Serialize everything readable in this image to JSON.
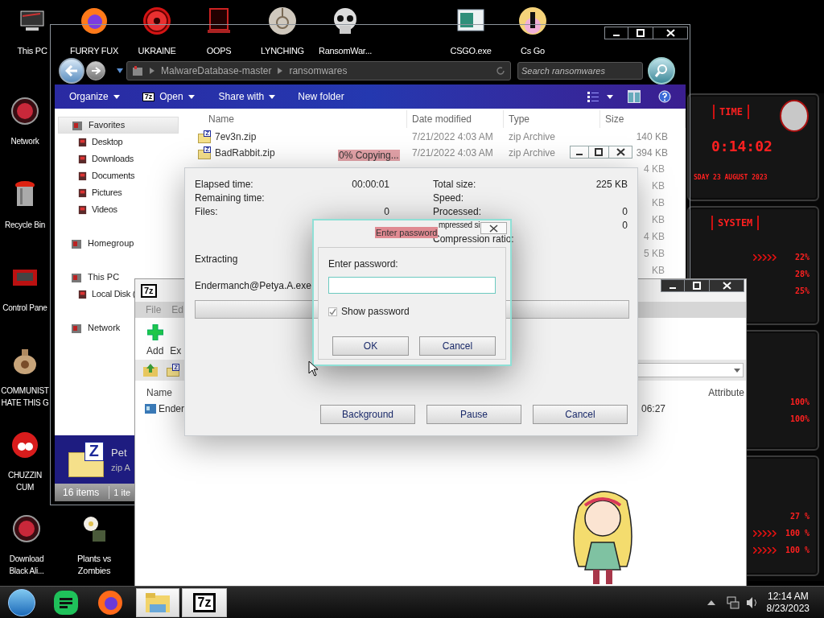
{
  "desktop_icons": {
    "top": [
      {
        "label": "This PC",
        "kind": "pc"
      },
      {
        "label": "FURRY FUX",
        "kind": "firefox"
      },
      {
        "label": "UKRAINE",
        "kind": "hazard"
      },
      {
        "label": "OOPS",
        "kind": "monitor"
      },
      {
        "label": "LYNCHING",
        "kind": "badge"
      },
      {
        "label": "RansomWar...",
        "kind": "skull"
      },
      {
        "label": "CSGO.exe",
        "kind": "window"
      },
      {
        "label": "Cs Go",
        "kind": "target"
      }
    ],
    "left": [
      {
        "label": "Network",
        "kind": "globe"
      },
      {
        "label": "Recycle Bin",
        "kind": "bin"
      },
      {
        "label": "Control Pane",
        "kind": "panel"
      },
      {
        "label": "COMMUNIST\nHATE THIS G",
        "kind": "money"
      },
      {
        "label": "CHUZZIN\nCUM",
        "kind": "creature"
      },
      {
        "label": "Download\nBlack Ali...",
        "kind": "globe"
      },
      {
        "label": "Plants vs\nZombies",
        "kind": "flower"
      }
    ]
  },
  "explorer": {
    "address": [
      "MalwareDatabase-master",
      "ransomwares"
    ],
    "search_placeholder": "Search ransomwares",
    "commands": [
      {
        "label": "Organize",
        "menu": true
      },
      {
        "label": "Open",
        "menu": true,
        "logo": "7z"
      },
      {
        "label": "Share with",
        "menu": true
      },
      {
        "label": "New folder",
        "menu": false
      }
    ],
    "nav": [
      {
        "label": "Favorites",
        "selected": true,
        "children": [
          {
            "label": "Desktop",
            "selected": false
          },
          {
            "label": "Downloads",
            "selected": false
          },
          {
            "label": "Documents",
            "selected": false
          },
          {
            "label": "Pictures",
            "selected": false
          },
          {
            "label": "Videos",
            "selected": false
          }
        ]
      },
      {
        "label": "Homegroup",
        "selected": false
      },
      {
        "label": "This PC",
        "selected": false,
        "children": [
          {
            "label": "Local Disk (",
            "selected": false
          }
        ]
      },
      {
        "label": "Network",
        "selected": false
      }
    ],
    "columns": [
      "Name",
      "Date modified",
      "Type",
      "Size"
    ],
    "rows": [
      {
        "icon_mark": "Z",
        "name": "7ev3n.zip",
        "date": "7/21/2022 4:03 AM",
        "type": "zip Archive",
        "size": "140 KB"
      },
      {
        "icon_mark": "Z",
        "name": "BadRabbit.zip",
        "date": "7/21/2022 4:03 AM",
        "type": "zip Archive",
        "size": "394 KB"
      }
    ],
    "size_fragments": [
      "4 KB",
      "KB",
      "KB",
      "KB",
      "4 KB",
      "5 KB",
      "KB"
    ],
    "details": {
      "icon_mark": "Z",
      "title": "Pet",
      "subtitle": "zip A"
    },
    "status": [
      "16 items",
      "1 ite"
    ]
  },
  "progress_dialog": {
    "title": "0% Copying...",
    "left_stats": [
      {
        "label": "Elapsed time:",
        "value": "00:00:01"
      },
      {
        "label": "Remaining time:"
      },
      {
        "label": "Files:",
        "value": "0"
      }
    ],
    "right_stats": [
      {
        "label": "Total size:",
        "value": "225 KB"
      },
      {
        "label": "Speed:"
      },
      {
        "label": "Processed:",
        "value": "0"
      },
      {
        "label": "mpressed si",
        "value": "0"
      },
      {
        "label": "Compression ratio:"
      }
    ],
    "status": "Extracting",
    "file": "Endermanch@Petya.A.exe",
    "progress": {
      "level": 0
    },
    "buttons": [
      "Background",
      "Pause",
      "Cancel"
    ]
  },
  "password_dialog": {
    "title": "Enter password",
    "prompt": "Enter password:",
    "show_password": {
      "label": "Show password",
      "checked": true
    },
    "buttons": [
      "OK",
      "Cancel"
    ]
  },
  "archive_window": {
    "logo": "7z",
    "menu": [
      "File",
      "Ed"
    ],
    "toolbar": [
      "Add",
      "Ex"
    ],
    "icon_mark": "Z",
    "columns": [
      "Name",
      "Attribute"
    ],
    "row": {
      "name": "Ender",
      "time": "06:27"
    }
  },
  "widget": {
    "time_title": "TIME",
    "time": "0:14:02",
    "date": "SDAY 23 AUGUST 2023",
    "system_title": "SYSTEM",
    "panels": [
      [
        "22%",
        "28%",
        "25%"
      ],
      [
        "100%",
        "100%"
      ],
      [
        "27 %",
        "100 %",
        "100 %"
      ]
    ]
  },
  "taskbar": {
    "apps": [
      {
        "kind": "orb"
      },
      {
        "kind": "notes"
      },
      {
        "kind": "firefox"
      },
      {
        "kind": "explorer"
      },
      {
        "kind": "archiver",
        "logo": "7z"
      }
    ],
    "time": "12:14 AM",
    "date": "8/23/2023"
  }
}
